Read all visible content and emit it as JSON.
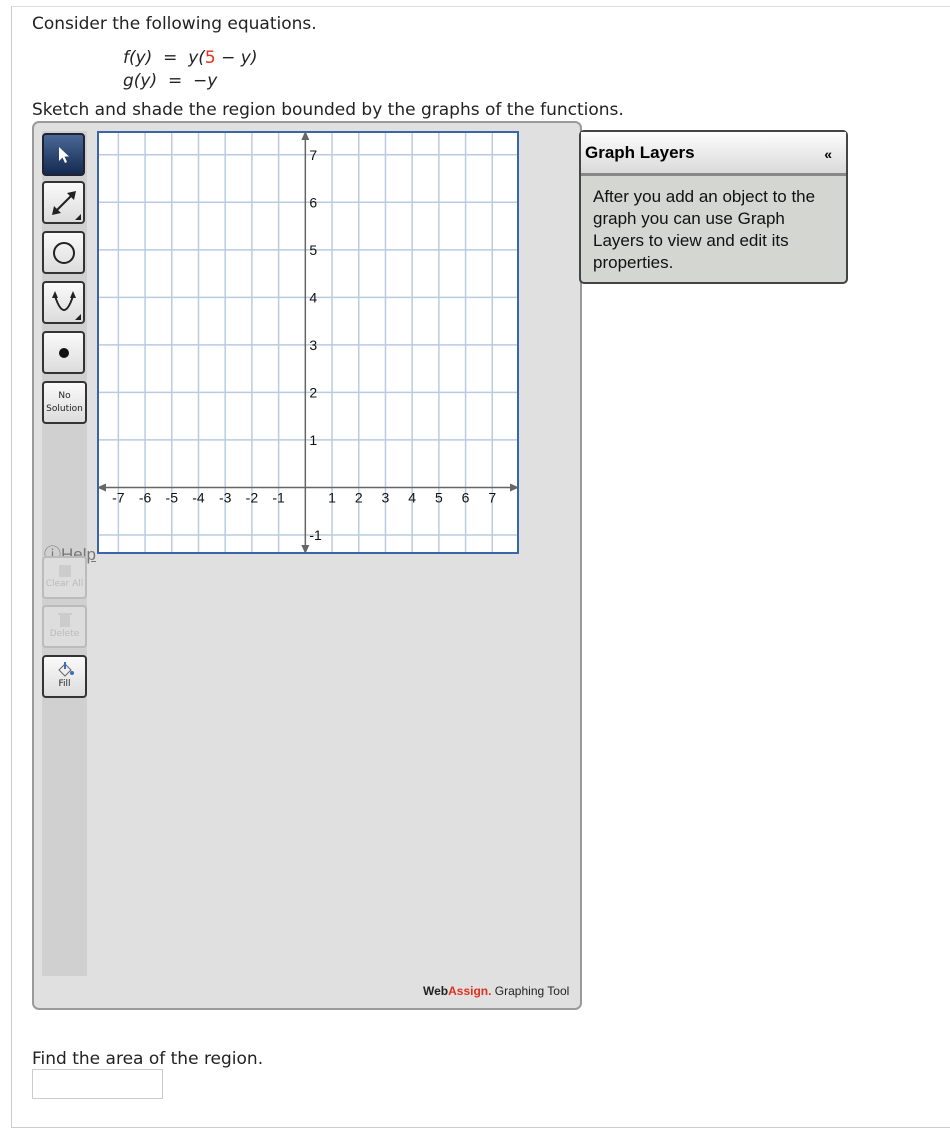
{
  "question": {
    "intro": "Consider the following equations.",
    "eq1": {
      "lhs": "f(y)",
      "eq": "=",
      "pre": "y(",
      "red": "5",
      "post": " − y)"
    },
    "eq2": {
      "lhs": "g(y)",
      "eq": "=",
      "rhs": "−y"
    },
    "instruction": "Sketch and shade the region bounded by the graphs of the functions.",
    "followup": "Find the area of the region.",
    "answer_value": ""
  },
  "toolbar": {
    "tools": [
      {
        "name": "select",
        "icon": "pointer-icon",
        "active": true
      },
      {
        "name": "line",
        "icon": "line-arrow-icon"
      },
      {
        "name": "circle",
        "icon": "circle-icon"
      },
      {
        "name": "parabola",
        "icon": "parabola-icon"
      },
      {
        "name": "point",
        "icon": "point-icon"
      }
    ],
    "no_solution_1": "No",
    "no_solution_2": "Solution",
    "help": "Help",
    "clear_all": "Clear All",
    "delete": "Delete",
    "fill": "Fill"
  },
  "graph": {
    "xlim": [
      -7.8,
      8
    ],
    "ylim": [
      -1.4,
      7.5
    ],
    "x_ticks": [
      -7,
      -6,
      -5,
      -4,
      -3,
      -2,
      -1,
      1,
      2,
      3,
      4,
      5,
      6,
      7
    ],
    "y_ticks": [
      -1,
      1,
      2,
      3,
      4,
      5,
      6,
      7
    ],
    "grid": true,
    "colors": {
      "grid": "#b9cbe0",
      "border": "#3a66a8",
      "axis": "#666666"
    }
  },
  "layers": {
    "title": "Graph Layers",
    "collapse": "«",
    "body": "After you add an object to the graph you can use Graph Layers to view and edit its properties."
  },
  "brand": {
    "web": "Web",
    "assign": "Assign.",
    "rest": " Graphing Tool",
    "accent": "#e0301e"
  }
}
